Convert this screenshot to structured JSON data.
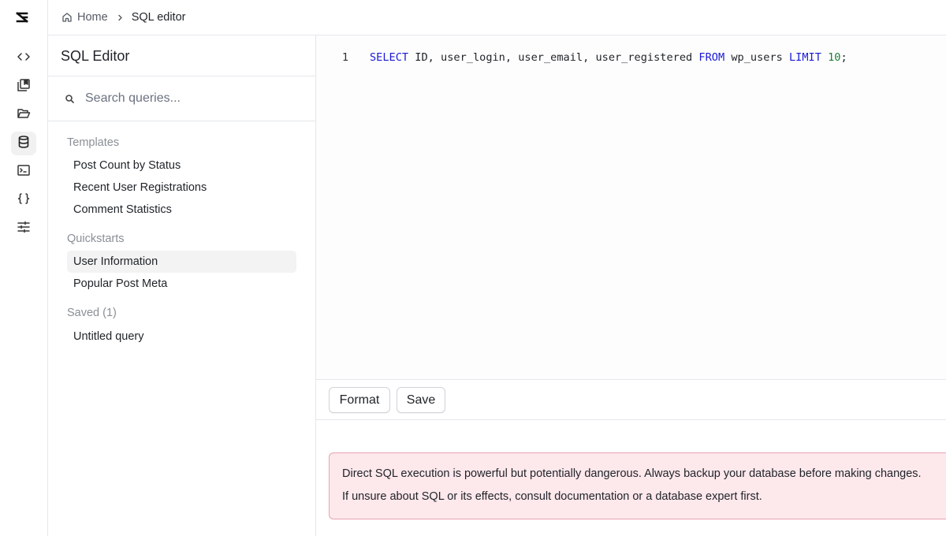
{
  "rail": {
    "items": [
      {
        "icon": "code-icon",
        "active": false
      },
      {
        "icon": "library-icon",
        "active": false
      },
      {
        "icon": "folder-open-icon",
        "active": false
      },
      {
        "icon": "database-icon",
        "active": true
      },
      {
        "icon": "terminal-icon",
        "active": false
      },
      {
        "icon": "braces-icon",
        "active": false
      },
      {
        "icon": "sliders-icon",
        "active": false
      }
    ]
  },
  "breadcrumb": {
    "home_label": "Home",
    "current_label": "SQL editor"
  },
  "panel": {
    "title": "SQL Editor",
    "search_placeholder": "Search queries...",
    "sections": {
      "templates": {
        "label": "Templates",
        "items": [
          "Post Count by Status",
          "Recent User Registrations",
          "Comment Statistics"
        ]
      },
      "quickstarts": {
        "label": "Quickstarts",
        "items": [
          "User Information",
          "Popular Post Meta"
        ],
        "selected": "User Information"
      },
      "saved": {
        "label": "Saved (1)",
        "items": [
          "Untitled query"
        ]
      }
    }
  },
  "editor": {
    "line_number": "1",
    "tokens": {
      "select": "SELECT",
      "columns": " ID, user_login, user_email, user_registered ",
      "from": "FROM",
      "table": " wp_users ",
      "limit": "LIMIT",
      "space": " ",
      "limit_value": "10",
      "terminator": ";"
    },
    "colors": {
      "keyword": "#1a1ad6",
      "number": "#1a7f37"
    }
  },
  "toolbar": {
    "format_label": "Format",
    "save_label": "Save"
  },
  "warning": {
    "line1": "Direct SQL execution is powerful but potentially dangerous. Always backup your database before making changes.",
    "line2": "If unsure about SQL or its effects, consult documentation or a database expert first.",
    "colors": {
      "background": "#fde8ec",
      "border": "#e8a3b2"
    }
  }
}
